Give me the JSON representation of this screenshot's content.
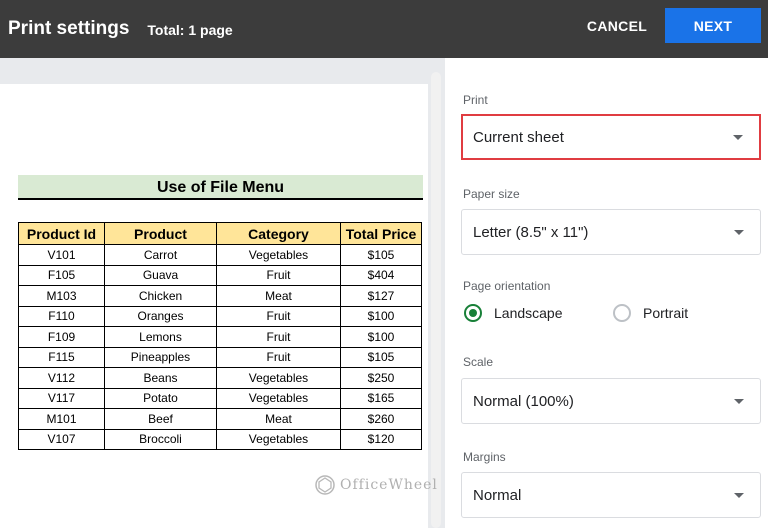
{
  "header": {
    "title": "Print settings",
    "total": "Total: 1 page",
    "cancel_label": "CANCEL",
    "next_label": "NEXT"
  },
  "sheet": {
    "title": "Use of File Menu",
    "columns": [
      "Product Id",
      "Product",
      "Category",
      "Total Price"
    ],
    "rows": [
      [
        "V101",
        "Carrot",
        "Vegetables",
        "$105"
      ],
      [
        "F105",
        "Guava",
        "Fruit",
        "$404"
      ],
      [
        "M103",
        "Chicken",
        "Meat",
        "$127"
      ],
      [
        "F110",
        "Oranges",
        "Fruit",
        "$100"
      ],
      [
        "F109",
        "Lemons",
        "Fruit",
        "$100"
      ],
      [
        "F115",
        "Pineapples",
        "Fruit",
        "$105"
      ],
      [
        "V112",
        "Beans",
        "Vegetables",
        "$250"
      ],
      [
        "V117",
        "Potato",
        "Vegetables",
        "$165"
      ],
      [
        "M101",
        "Beef",
        "Meat",
        "$260"
      ],
      [
        "V107",
        "Broccoli",
        "Vegetables",
        "$120"
      ]
    ]
  },
  "watermark": "OfficeWheel",
  "settings": {
    "print": {
      "label": "Print",
      "value": "Current sheet"
    },
    "paper_size": {
      "label": "Paper size",
      "value": "Letter (8.5\" x 11\")"
    },
    "orientation": {
      "label": "Page orientation",
      "options": [
        "Landscape",
        "Portrait"
      ],
      "selected": "Landscape"
    },
    "scale": {
      "label": "Scale",
      "value": "Normal (100%)"
    },
    "margins": {
      "label": "Margins",
      "value": "Normal"
    }
  },
  "colors": {
    "header_bg": "#3c3c3c",
    "accent": "#1a73e8",
    "highlight": "#e03c41",
    "radio_checked": "#188038",
    "title_band": "#d9ead3",
    "table_header": "#ffe599"
  }
}
